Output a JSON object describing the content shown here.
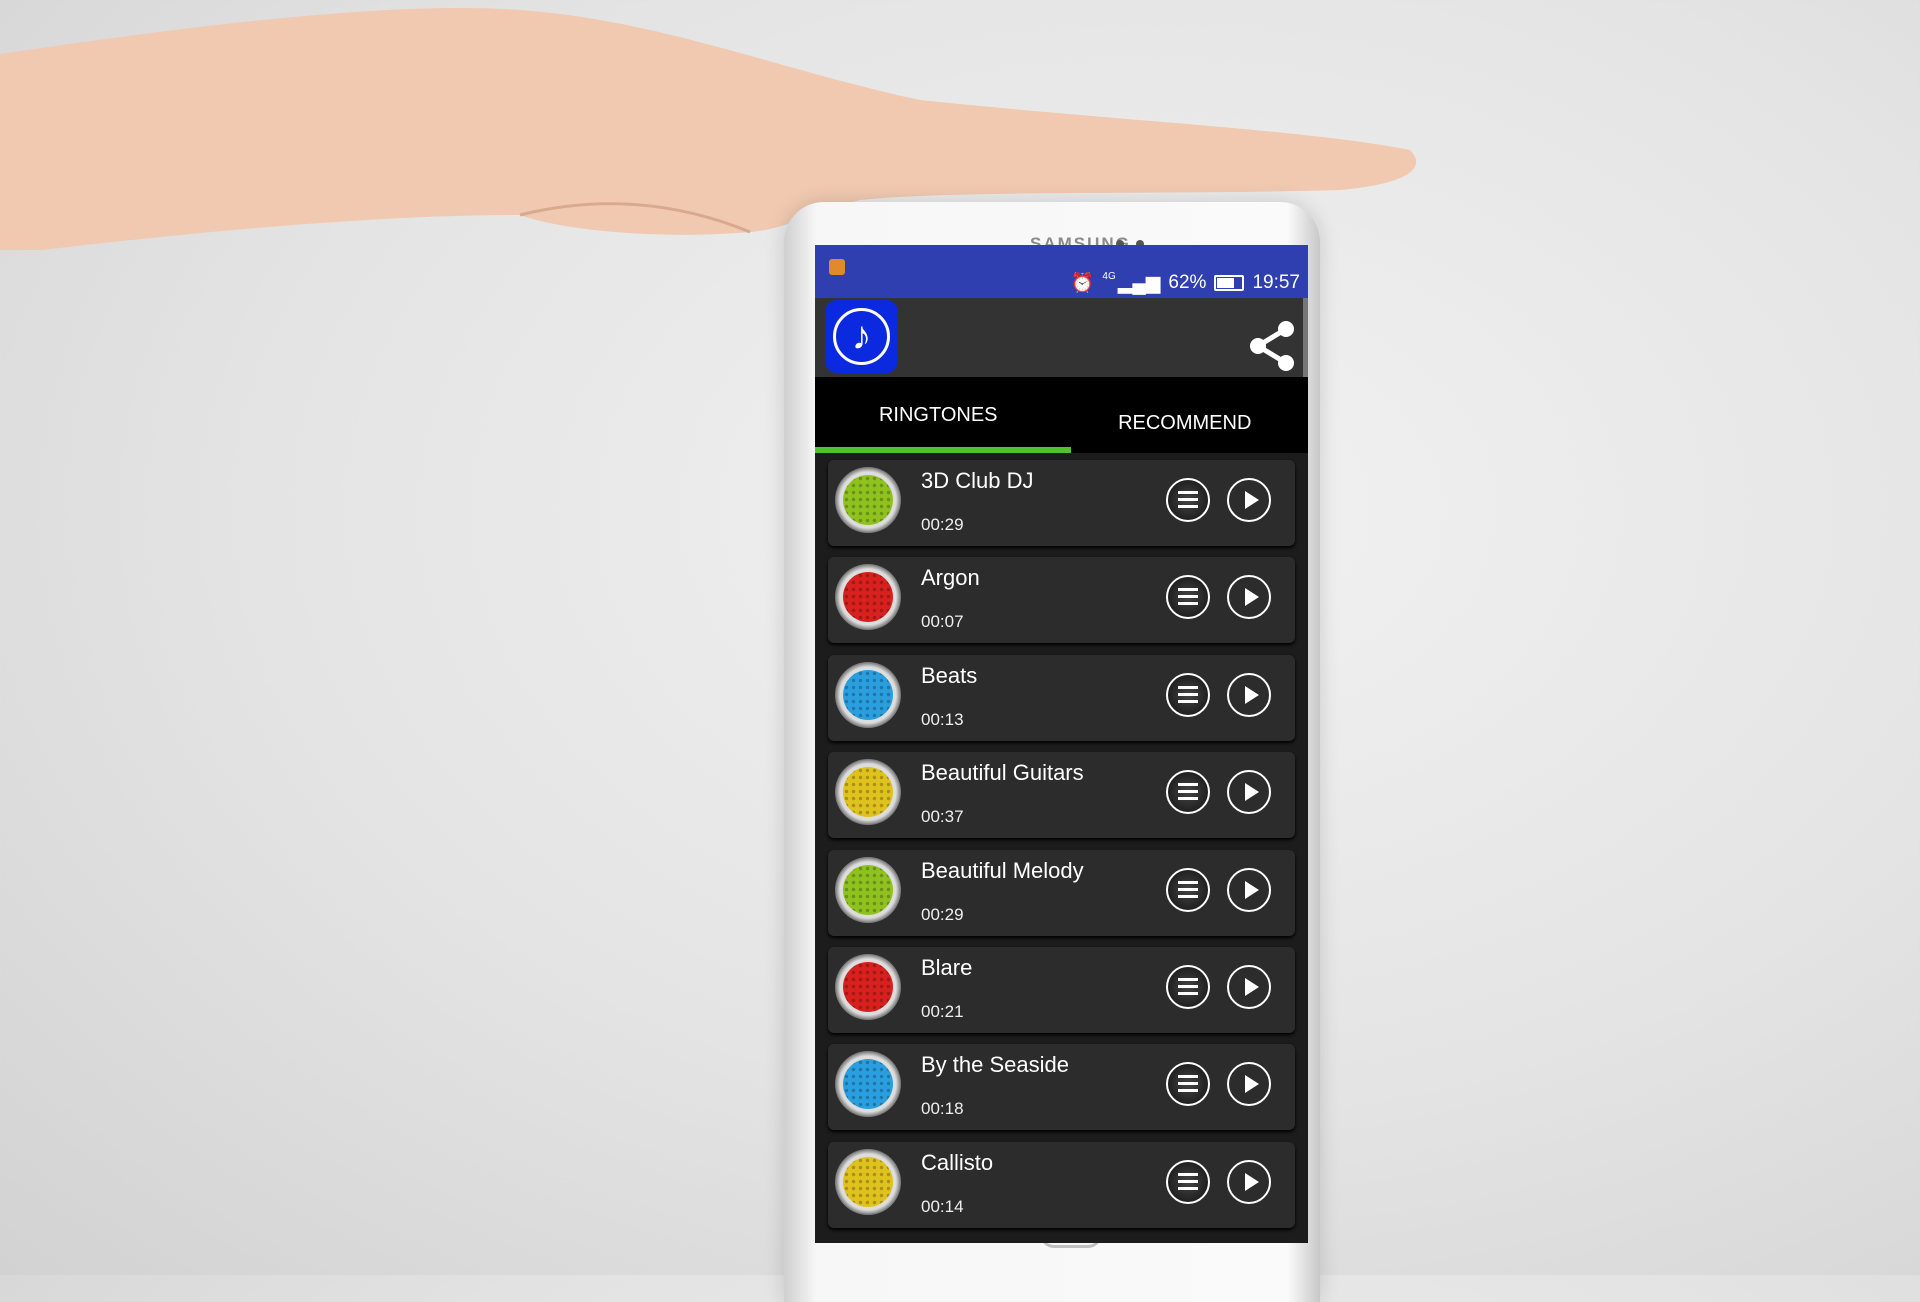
{
  "device": {
    "brand": "SAMSUNG"
  },
  "status_bar": {
    "network": "4G",
    "battery": "62%",
    "time": "19:57",
    "icons": [
      "notification-app-icon",
      "alarm-icon",
      "signal-icon",
      "battery-icon"
    ]
  },
  "header": {
    "app_icon": "music-note-icon",
    "share_icon": "share-icon"
  },
  "tabs": [
    {
      "label": "RINGTONES",
      "active": true
    },
    {
      "label": "RECOMMEND",
      "active": false
    }
  ],
  "colors": {
    "status_bar": "#2f3fb0",
    "accent": "#4fc32b",
    "app_icon": "#0b2ae0"
  },
  "ringtones": [
    {
      "title": "3D Club DJ",
      "duration": "00:29",
      "color": "#8fc21f"
    },
    {
      "title": "Argon",
      "duration": "00:07",
      "color": "#d8201e"
    },
    {
      "title": "Beats",
      "duration": "00:13",
      "color": "#2a9fe0"
    },
    {
      "title": "Beautiful Guitars",
      "duration": "00:37",
      "color": "#e0c21e"
    },
    {
      "title": "Beautiful Melody",
      "duration": "00:29",
      "color": "#8fc21f"
    },
    {
      "title": "Blare",
      "duration": "00:21",
      "color": "#d8201e"
    },
    {
      "title": "By the Seaside",
      "duration": "00:18",
      "color": "#2a9fe0"
    },
    {
      "title": "Callisto",
      "duration": "00:14",
      "color": "#e0c21e"
    }
  ]
}
